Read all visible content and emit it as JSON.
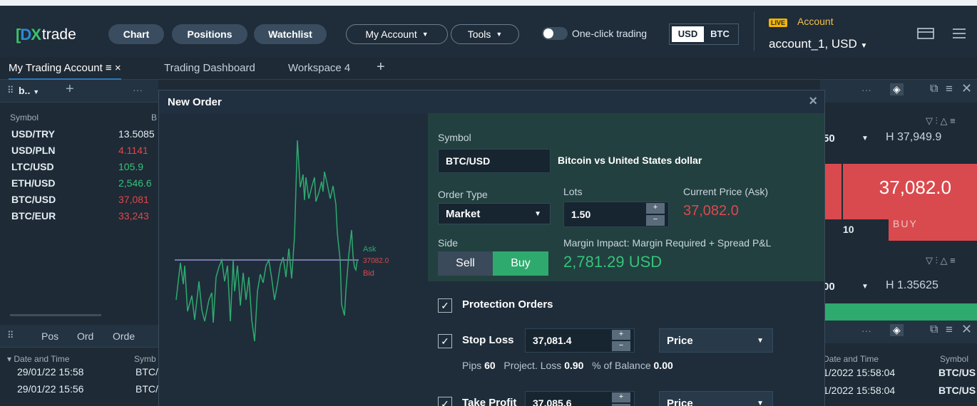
{
  "topbar": {
    "logo_text": "trade",
    "nav": [
      "Chart",
      "Positions",
      "Watchlist"
    ],
    "my_account": "My Account",
    "tools": "Tools",
    "one_click": "One-click trading",
    "currencies": [
      "USD",
      "BTC"
    ],
    "live_badge": "LIVE",
    "account_label": "Account",
    "account_name": "account_1, USD"
  },
  "workspace_tabs": [
    "My Trading Account",
    "Trading Dashboard",
    "Workspace 4"
  ],
  "watchlist": {
    "header": "b..",
    "col_symbol": "Symbol",
    "col_bid": "B",
    "rows": [
      {
        "symbol": "USD/TRY",
        "value": "13.5085",
        "color": "#e4ecf3"
      },
      {
        "symbol": "USD/PLN",
        "value": "4.1141",
        "color": "#e0474c"
      },
      {
        "symbol": "LTC/USD",
        "value": "105.9",
        "color": "#35c27a"
      },
      {
        "symbol": "ETH/USD",
        "value": "2,546.6",
        "color": "#35c27a"
      },
      {
        "symbol": "BTC/USD",
        "value": "37,081",
        "color": "#e0474c"
      },
      {
        "symbol": "BTC/EUR",
        "value": "33,243",
        "color": "#e0474c"
      }
    ]
  },
  "bottom_panel": {
    "tabs": [
      "Pos",
      "Ord",
      "Orde"
    ],
    "col_date": "Date and Time",
    "col_symbol": "Symb",
    "rows": [
      {
        "date": "29/01/22 15:58",
        "symbol": "BTC/"
      },
      {
        "date": "29/01/22 15:56",
        "symbol": "BTC/"
      }
    ]
  },
  "right_panel": {
    "qty1": "50",
    "high1": "H 37,949.9",
    "ask_price": "37,082.0",
    "buy_label": "BUY",
    "size": "10",
    "qty2": "00",
    "high2": "H 1.35625",
    "col_date": "Date and Time",
    "col_symbol": "Symbol",
    "rows": [
      {
        "date": "1/2022 15:58:04",
        "symbol": "BTC/US"
      },
      {
        "date": "1/2022 15:58:04",
        "symbol": "BTC/US"
      }
    ]
  },
  "modal": {
    "title": "New Order",
    "chart_ask": "Ask",
    "chart_price": "37082.0",
    "chart_bid": "Bid",
    "symbol_label": "Symbol",
    "symbol_value": "BTC/USD",
    "symbol_desc": "Bitcoin vs United States dollar",
    "order_type_label": "Order Type",
    "order_type_value": "Market",
    "lots_label": "Lots",
    "lots_value": "1.50",
    "current_price_label": "Current Price (Ask)",
    "current_price_value": "37,082.0",
    "side_label": "Side",
    "sell": "Sell",
    "buy": "Buy",
    "margin_label": "Margin Impact: Margin Required + Spread P&L",
    "margin_value": "2,781.29 USD",
    "protection_label": "Protection Orders",
    "stop_loss_label": "Stop Loss",
    "stop_loss_value": "37,081.4",
    "stop_loss_type": "Price",
    "pips_label": "Pips",
    "pips_value": "60",
    "proj_loss_label": "Project. Loss",
    "proj_loss_value": "0.90",
    "balance_label": "% of Balance",
    "balance_value": "0.00",
    "take_profit_label": "Take Profit",
    "take_profit_value": "37,085.6",
    "take_profit_type": "Price"
  },
  "colors": {
    "buy": "#2eaa6e",
    "sell_red": "#e0474c",
    "accent_blue": "#2c7ab8"
  }
}
